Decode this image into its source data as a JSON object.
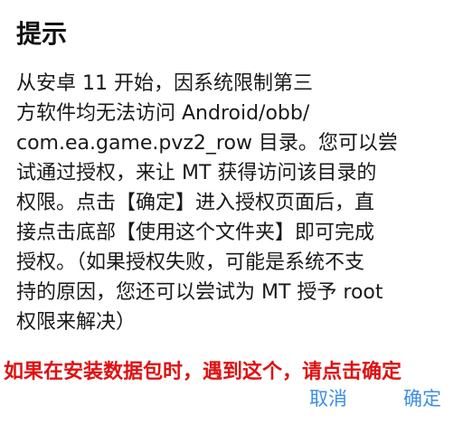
{
  "dialog": {
    "title": "提示",
    "message_lines": [
      "从安卓 11 开始，因系统限制第三",
      "方软件均无法访问 Android/obb/",
      "com.ea.game.pvz2_row 目录。您可以尝",
      "试通过授权，来让 MT 获得访问该目录的",
      "权限。点击【确定】进入授权页面后，直",
      "接点击底部【使用这个文件夹】即可完成",
      "授权。（如果授权失败，可能是系统不支",
      "持的原因，您还可以尝试为 MT 授予 root",
      "权限来解决）"
    ],
    "overlay_note": "如果在安装数据包时，遇到这个，请点击确定",
    "buttons": {
      "cancel_label": "取消",
      "ok_label": "确定"
    }
  },
  "colors": {
    "accent": "#3d8ee6",
    "overlay_note": "#e01010",
    "text": "#1a1a1a",
    "background": "#ffffff"
  }
}
